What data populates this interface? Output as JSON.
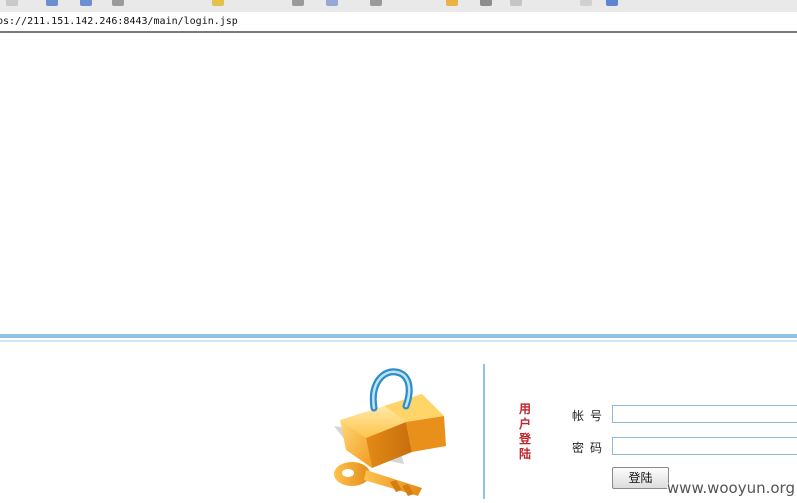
{
  "browser": {
    "address_url": "ps://211.151.142.246:8443/main/login.jsp"
  },
  "login": {
    "title": "用户登陆",
    "account_label": "帐号",
    "account_value": "",
    "password_label": "密码",
    "password_value": "",
    "submit_label": "登陆"
  },
  "watermark": "www.wooyun.org",
  "colors": {
    "accent_blue": "#8ec3e6",
    "title_red": "#c0262c",
    "lock_orange": "#f5a623",
    "shackle_blue": "#2e8ec9"
  },
  "icons": {
    "logo": "lock-and-key-icon"
  }
}
